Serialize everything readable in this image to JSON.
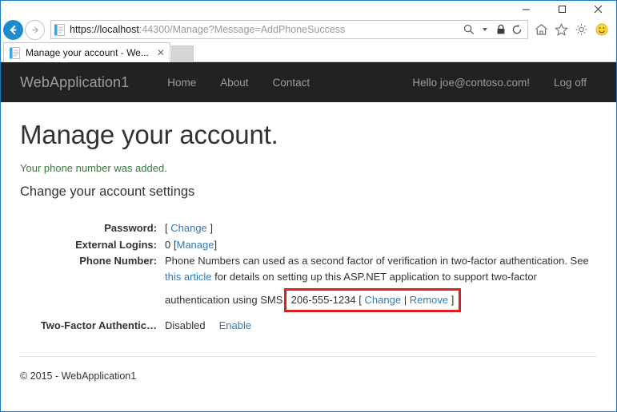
{
  "browser": {
    "window_controls": {
      "minimize": "─",
      "maximize": "☐",
      "close": "✕"
    },
    "back_icon": "back-arrow-icon",
    "forward_icon": "forward-arrow-icon",
    "address": {
      "scheme_host": "https://localhost",
      "path": ":44300/Manage?Message=AddPhoneSuccess",
      "full_url": "https://localhost:44300/Manage?Message=AddPhoneSuccess"
    },
    "address_icons": [
      "search-icon",
      "chevron-down-icon",
      "lock-icon",
      "refresh-icon"
    ],
    "toolbar_icons": [
      "home-icon",
      "favorites-star-icon",
      "settings-gear-icon",
      "smiley-feedback-icon"
    ],
    "tab": {
      "title": "Manage your account - We...",
      "close_label": "✕"
    },
    "new_tab_label": ""
  },
  "site": {
    "brand": "WebApplication1",
    "nav": [
      {
        "label": "Home"
      },
      {
        "label": "About"
      },
      {
        "label": "Contact"
      }
    ],
    "user_greeting": "Hello joe@contoso.com!",
    "logoff_label": "Log off"
  },
  "page": {
    "title": "Manage your account.",
    "success_message": "Your phone number was added.",
    "subheading": "Change your account settings",
    "rows": {
      "password": {
        "term": "Password:",
        "open_bracket": "[",
        "link": "Change",
        "close_bracket": "]"
      },
      "external_logins": {
        "term": "External Logins:",
        "count": "0",
        "open_bracket": "[",
        "link": "Manage",
        "close_bracket": "]"
      },
      "phone_number": {
        "term": "Phone Number:",
        "desc_part1": "Phone Numbers can used as a second factor of verification in two-factor authentication. See ",
        "desc_link": "this article",
        "desc_part2": " for details on setting up this ASP.NET application to support two-factor authentication using SMS.",
        "value": "206-555-1234",
        "open_bracket": "[",
        "change_link": "Change",
        "separator": "|",
        "remove_link": "Remove",
        "close_bracket": "]"
      },
      "two_factor": {
        "term": "Two-Factor Authentic…",
        "state": "Disabled",
        "action_link": "Enable"
      }
    },
    "footer": "© 2015 - WebApplication1"
  },
  "colors": {
    "navbar_bg": "#222222",
    "navbar_text": "#9d9d9d",
    "link": "#337ab7",
    "success": "#3c763d",
    "highlight_border": "#e02020",
    "browser_accent": "#1e8bcd"
  }
}
